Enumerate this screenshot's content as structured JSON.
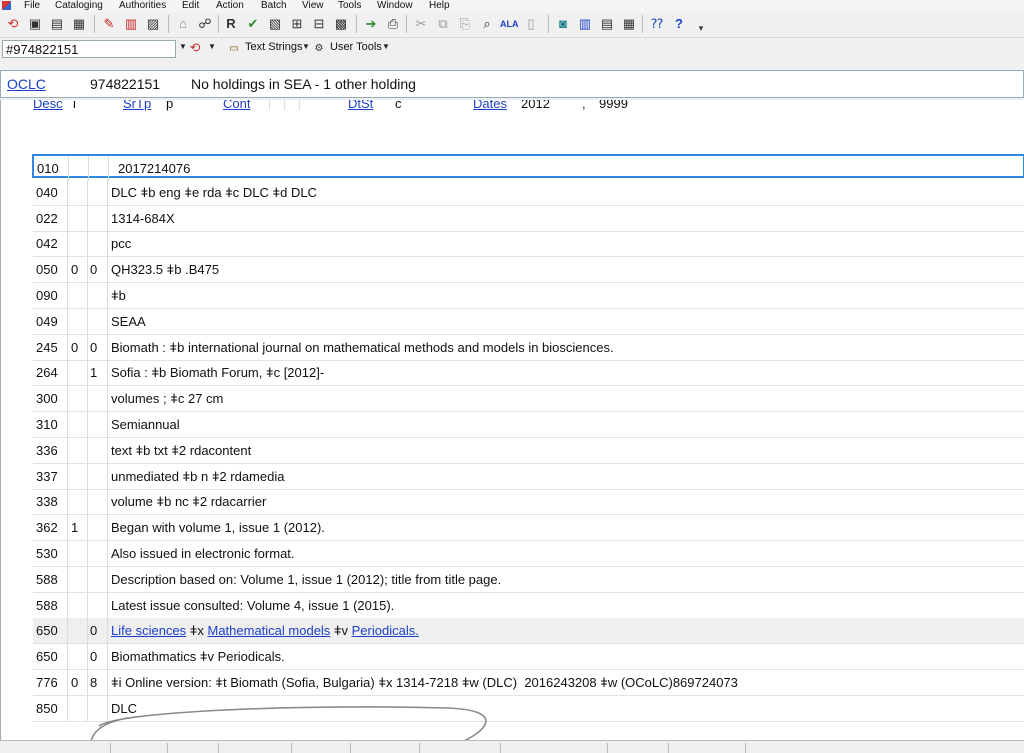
{
  "menu": [
    "File",
    "Cataloging",
    "Authorities",
    "Edit",
    "Action",
    "Batch",
    "View",
    "Tools",
    "Window",
    "Help"
  ],
  "search": {
    "value": "#974822151"
  },
  "toolbar2": {
    "text_strings": "Text Strings",
    "user_tools": "User Tools"
  },
  "status": {
    "oclc_link": "OCLC",
    "number": "974822151",
    "holdings": "No holdings in SEA - 1 other holding"
  },
  "fixed_field": {
    "desc_label": "Desc",
    "desc_value": "i",
    "srtp_label": "SrTp",
    "srtp_value": "p",
    "cont_label": "Cont",
    "dtst_label": "DtSt",
    "dtst_value": "c",
    "dates_label": "Dates",
    "date1": "2012",
    "date_sep": ",",
    "date2": "9999"
  },
  "fields": [
    {
      "tag": "010",
      "ind1": "",
      "ind2": "",
      "text": "2017214076"
    },
    {
      "tag": "040",
      "ind1": "",
      "ind2": "",
      "text": "DLC ǂb eng ǂe rda ǂc DLC ǂd DLC"
    },
    {
      "tag": "022",
      "ind1": "",
      "ind2": "",
      "text": "1314-684X"
    },
    {
      "tag": "042",
      "ind1": "",
      "ind2": "",
      "text": "pcc"
    },
    {
      "tag": "050",
      "ind1": "0",
      "ind2": "0",
      "text": "QH323.5 ǂb .B475"
    },
    {
      "tag": "090",
      "ind1": "",
      "ind2": "",
      "text": "ǂb"
    },
    {
      "tag": "049",
      "ind1": "",
      "ind2": "",
      "text": "SEAA"
    },
    {
      "tag": "245",
      "ind1": "0",
      "ind2": "0",
      "text": "Biomath : ǂb international journal on mathematical methods and models in biosciences."
    },
    {
      "tag": "264",
      "ind1": "",
      "ind2": "1",
      "text": "Sofia : ǂb Biomath Forum, ǂc [2012]-"
    },
    {
      "tag": "300",
      "ind1": "",
      "ind2": "",
      "text": "volumes ; ǂc 27 cm"
    },
    {
      "tag": "310",
      "ind1": "",
      "ind2": "",
      "text": "Semiannual"
    },
    {
      "tag": "336",
      "ind1": "",
      "ind2": "",
      "text": "text ǂb txt ǂ2 rdacontent"
    },
    {
      "tag": "337",
      "ind1": "",
      "ind2": "",
      "text": "unmediated ǂb n ǂ2 rdamedia"
    },
    {
      "tag": "338",
      "ind1": "",
      "ind2": "",
      "text": "volume ǂb nc ǂ2 rdacarrier"
    },
    {
      "tag": "362",
      "ind1": "1",
      "ind2": "",
      "text": "Began with volume 1, issue 1 (2012)."
    },
    {
      "tag": "530",
      "ind1": "",
      "ind2": "",
      "text": "Also issued in electronic format."
    },
    {
      "tag": "588",
      "ind1": "",
      "ind2": "",
      "text": "Description based on: Volume 1, issue 1 (2012); title from title page."
    },
    {
      "tag": "588",
      "ind1": "",
      "ind2": "",
      "text": "Latest issue consulted: Volume 4, issue 1 (2015)."
    },
    {
      "tag": "650",
      "ind1": "",
      "ind2": "0",
      "link1": "Life sciences",
      "mid1": " ǂx ",
      "link2": "Mathematical models",
      "mid2": " ǂv ",
      "link3": "Periodicals."
    },
    {
      "tag": "650",
      "ind1": "",
      "ind2": "0",
      "text": "Biomathmatics ǂv Periodicals."
    },
    {
      "tag": "776",
      "ind1": "0",
      "ind2": "8",
      "text": "ǂi Online version: ǂt Biomath (Sofia, Bulgaria) ǂx 1314-7218 ǂw (DLC)  2016243208 ǂw (OCoLC)869724073"
    },
    {
      "tag": "850",
      "ind1": "",
      "ind2": "",
      "text": "DLC"
    }
  ]
}
